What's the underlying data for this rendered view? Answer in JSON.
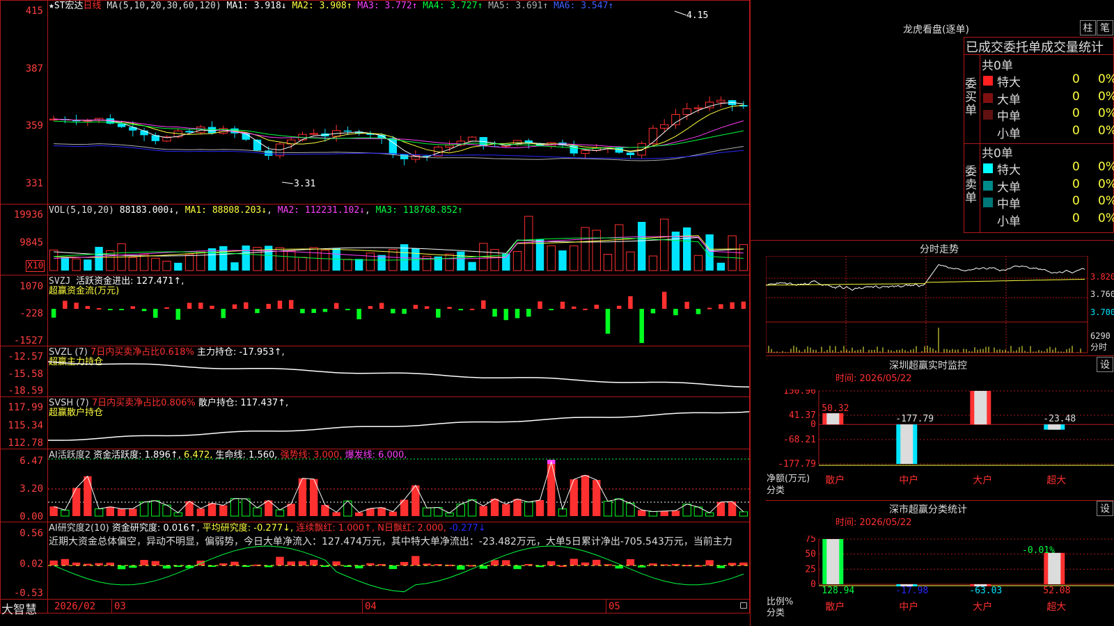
{
  "colors": {
    "up": "#ff3030",
    "down": "#00e5ff",
    "flat": "#ffffff",
    "ma1": "#ffffff",
    "ma2": "#ffff40",
    "ma3": "#ff40ff",
    "ma4": "#00ff40",
    "ma5": "#b0b0b0",
    "ma6": "#2828ff",
    "grid": "#b01818",
    "green": "#00ff20"
  },
  "main": {
    "star": "★",
    "name": "ST宏达",
    "period": "日线",
    "ma_label": "MA(5,10,20,30,60,120)",
    "ma1": "MA1: 3.918↓",
    "ma2": "MA2: 3.908↑",
    "ma3": "MA3: 3.772↑",
    "ma4": "MA4: 3.727↑",
    "ma5": "MA5: 3.691↑",
    "ma6": "MA6: 3.547↑",
    "axis": [
      "415",
      "387",
      "359",
      "331"
    ],
    "high_label": "4.15",
    "low_label": "3.31"
  },
  "vol": {
    "label": "VOL(5,10,20)",
    "value": "88183.000↓",
    "ma1": "MA1: 88808.203↓",
    "ma2": "MA2: 112231.102↓",
    "ma3": "MA3: 118768.852↑",
    "axis": [
      "19936",
      "9845"
    ],
    "unit": "X10"
  },
  "svzj": {
    "label": "SVZJ",
    "l1": "活跃资金进出: 127.471↑,",
    "l2": "超赢资金流(万元)",
    "axis": [
      "1070",
      "-228",
      "-1527"
    ]
  },
  "svzl": {
    "label": "SVZL (7)",
    "l1": "7日内买卖净占比0.618%",
    "l2": "主力持仓: -17.953↑,",
    "l3": "超赢主力持仓",
    "axis": [
      "-12.57",
      "-15.58",
      "-18.59"
    ]
  },
  "svsh": {
    "label": "SVSH (7)",
    "l1": "7日内买卖净占比0.806%",
    "l2": "散户持仓: 117.437↑,",
    "l3": "超赢散户持仓",
    "axis": [
      "117.99",
      "115.34",
      "112.78"
    ]
  },
  "ai1": {
    "label": "AI活跃度2",
    "l1": "资金活跃度: 1.896↑,",
    "l2": "6.472,",
    "l3": "生命线: 1.560,",
    "l4": "强势线: 3.000,",
    "l5": "爆发线: 6.000,",
    "axis": [
      "6.47",
      "3.20",
      "0.00"
    ]
  },
  "ai2": {
    "label": "AI研究度2(10)",
    "l1": "资金研究度: 0.016↑,",
    "l2": "平均研究度: -0.277↓,",
    "l3": "连续飘红: 1.000↑,",
    "l4": "N日飘红: 2.000,",
    "l5": "-0.277↓",
    "text": "近期大资金总体偏空，异动不明显，偏弱势，今日大单净流入：127.474万元，其中特大单净流出：-23.482万元，大单5日累计净出-705.543万元，当前主力",
    "axis": [
      "0.56",
      "0.02",
      "-0.53"
    ]
  },
  "bottom": {
    "brand": "大智慧",
    "dates": [
      "2026/02",
      "03",
      "04",
      "05"
    ]
  },
  "lhkp": {
    "title": "龙虎看盘(逐单)",
    "btn1": "柱",
    "btn2": "笔",
    "tabs": "已成交委托单成交量统计",
    "buy_label": "委买单",
    "sell_label": "委卖单",
    "buy_total": "共0单",
    "sell_total": "共0单",
    "buy_rows": [
      {
        "name": "特大",
        "count": "0",
        "pct": "0%",
        "color": "#ff2020"
      },
      {
        "name": "大单",
        "count": "0",
        "pct": "0%",
        "color": "#801010"
      },
      {
        "name": "中单",
        "count": "0",
        "pct": "0%",
        "color": "#601010"
      },
      {
        "name": "小单",
        "count": "0",
        "pct": "0%",
        "color": "#000000"
      }
    ],
    "sell_rows": [
      {
        "name": "特大",
        "count": "0",
        "pct": "0%",
        "color": "#00ffff"
      },
      {
        "name": "大单",
        "count": "0",
        "pct": "0%",
        "color": "#008b8b"
      },
      {
        "name": "中单",
        "count": "0",
        "pct": "0%",
        "color": "#007878"
      },
      {
        "name": "小单",
        "count": "0",
        "pct": "0%",
        "color": "#000000"
      }
    ]
  },
  "fszs": {
    "title": "分时走势",
    "axis": [
      "3.820",
      "3.760",
      "3.700",
      "6290"
    ],
    "unit": "分时"
  },
  "szjk": {
    "title": "深圳超赢实时监控",
    "btn": "设",
    "time": "时间: 2026/05/22",
    "axis": [
      "150.96",
      "41.37",
      "0",
      "-68.21",
      "-177.79"
    ],
    "ylabel": "净额(万元)",
    "xlabel": "分类",
    "cats": [
      "散户",
      "中户",
      "大户",
      "超大"
    ],
    "values": [
      50.32,
      -177.79,
      150.96,
      -23.48
    ],
    "value_labels": [
      "50.32",
      "-177.79",
      "150.96",
      "-23.48"
    ]
  },
  "szfl": {
    "title": "深市超赢分类统计",
    "btn": "设",
    "time": "时间: 2026/05/22",
    "axis": [
      "75",
      "50",
      "25",
      "0"
    ],
    "ylabel": "比例%",
    "xlabel": "分类",
    "cats": [
      "散户",
      "中户",
      "大户",
      "超大"
    ],
    "values": [
      128.94,
      -17.98,
      -63.03,
      52.08
    ],
    "value_labels": [
      "128.94",
      "-17.98",
      "-63.03",
      "52.08"
    ],
    "top_label": "-0.01%"
  },
  "chart_data": [
    {
      "type": "bar",
      "title": "深圳超赢实时监控",
      "ylabel": "净额(万元)",
      "xlabel": "分类",
      "categories": [
        "散户",
        "中户",
        "大户",
        "超大"
      ],
      "values": [
        50.32,
        -177.79,
        150.96,
        -23.48
      ],
      "ylim": [
        -177.79,
        150.96
      ]
    },
    {
      "type": "bar",
      "title": "深市超赢分类统计",
      "ylabel": "比例%",
      "xlabel": "分类",
      "categories": [
        "散户",
        "中户",
        "大户",
        "超大"
      ],
      "values": [
        128.94,
        -17.98,
        -63.03,
        52.08
      ],
      "ylim": [
        0,
        75
      ]
    }
  ]
}
